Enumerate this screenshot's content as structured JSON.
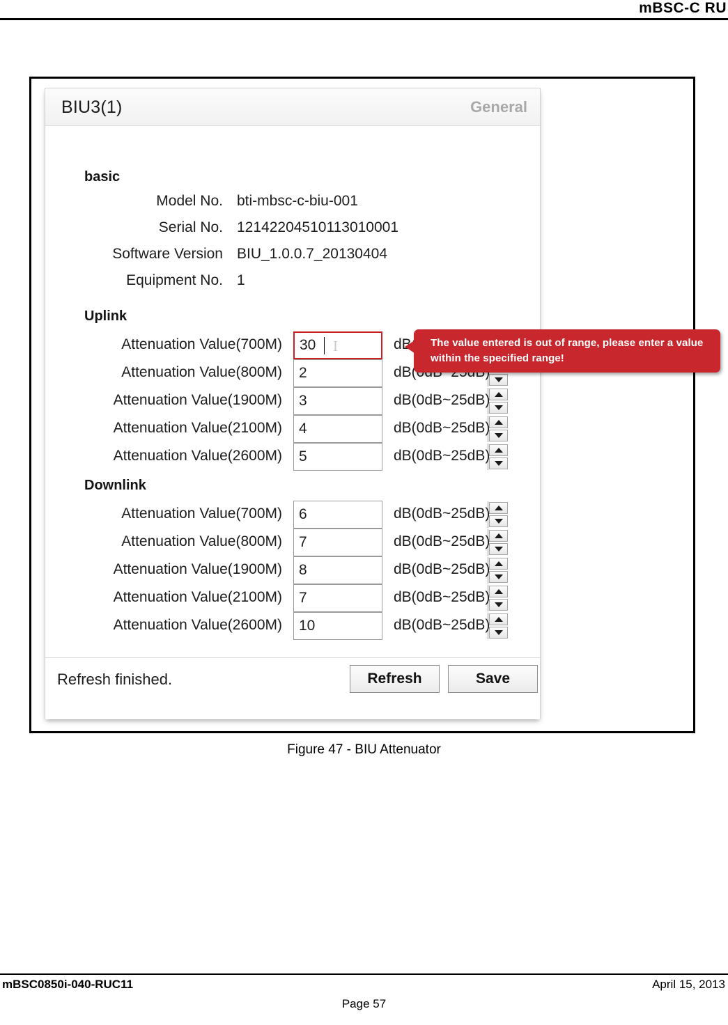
{
  "document": {
    "header_text": "mBSC-C   RU",
    "caption": "Figure 47 - BIU Attenuator",
    "footer_left": "mBSC0850i-040-RUC11",
    "footer_right": "April 15, 2013",
    "footer_center": "Page 57"
  },
  "panel": {
    "title": "BIU3(1)",
    "tab_label": "General"
  },
  "sections": {
    "basic_title": "basic",
    "uplink_title": "Uplink",
    "downlink_title": "Downlink"
  },
  "basic": [
    {
      "label": "Model No.",
      "value": "bti-mbsc-c-biu-001"
    },
    {
      "label": "Serial No.",
      "value": "12142204510113010001"
    },
    {
      "label": "Software Version",
      "value": "BIU_1.0.0.7_20130404"
    },
    {
      "label": "Equipment No.",
      "value": "1"
    }
  ],
  "uplink": [
    {
      "label": "Attenuation Value(700M)",
      "value": "30",
      "unit": "dB(0dB~25dB)",
      "error": true
    },
    {
      "label": "Attenuation Value(800M)",
      "value": "2",
      "unit": "dB(0dB~25dB)",
      "error": false
    },
    {
      "label": "Attenuation Value(1900M)",
      "value": "3",
      "unit": "dB(0dB~25dB)",
      "error": false
    },
    {
      "label": "Attenuation Value(2100M)",
      "value": "4",
      "unit": "dB(0dB~25dB)",
      "error": false
    },
    {
      "label": "Attenuation Value(2600M)",
      "value": "5",
      "unit": "dB(0dB~25dB)",
      "error": false
    }
  ],
  "downlink": [
    {
      "label": "Attenuation Value(700M)",
      "value": "6",
      "unit": "dB(0dB~25dB)"
    },
    {
      "label": "Attenuation Value(800M)",
      "value": "7",
      "unit": "dB(0dB~25dB)"
    },
    {
      "label": "Attenuation Value(1900M)",
      "value": "8",
      "unit": "dB(0dB~25dB)"
    },
    {
      "label": "Attenuation Value(2100M)",
      "value": "7",
      "unit": "dB(0dB~25dB)"
    },
    {
      "label": "Attenuation Value(2600M)",
      "value": "10",
      "unit": "dB(0dB~25dB)"
    }
  ],
  "tooltip": {
    "message": "The value entered is out of range, please enter a value within the specified range!",
    "color": "#c8272d"
  },
  "footer": {
    "status": "Refresh finished.",
    "refresh_label": "Refresh",
    "save_label": "Save"
  }
}
